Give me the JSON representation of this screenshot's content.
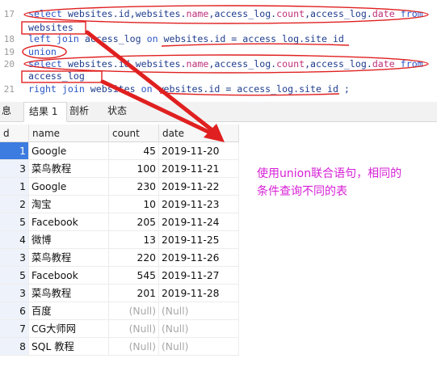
{
  "editor": {
    "lines": [
      {
        "num": "17",
        "tokens": [
          {
            "t": "select ",
            "c": "kw"
          },
          {
            "t": "websites.id,websites.",
            "c": "plain"
          },
          {
            "t": "name",
            "c": "fn"
          },
          {
            "t": ",access_log.",
            "c": "plain"
          },
          {
            "t": "count",
            "c": "fn"
          },
          {
            "t": ",access_log.",
            "c": "plain"
          },
          {
            "t": "date",
            "c": "fn"
          },
          {
            "t": " from",
            "c": "kw"
          }
        ]
      },
      {
        "num": "",
        "tokens": [
          {
            "t": "websites",
            "c": "plain"
          }
        ]
      },
      {
        "num": "18",
        "tokens": [
          {
            "t": "left join ",
            "c": "kw"
          },
          {
            "t": "access_log ",
            "c": "plain"
          },
          {
            "t": "on ",
            "c": "kw"
          },
          {
            "t": "websites.id = access_log.site_id",
            "c": "plain"
          }
        ]
      },
      {
        "num": "19",
        "tokens": [
          {
            "t": "union",
            "c": "kw"
          }
        ]
      },
      {
        "num": "20",
        "tokens": [
          {
            "t": "select ",
            "c": "kw"
          },
          {
            "t": "websites.id,websites.",
            "c": "plain"
          },
          {
            "t": "name",
            "c": "fn"
          },
          {
            "t": ",access_log.",
            "c": "plain"
          },
          {
            "t": "count",
            "c": "fn"
          },
          {
            "t": ",access_log.",
            "c": "plain"
          },
          {
            "t": "date",
            "c": "fn"
          },
          {
            "t": " from",
            "c": "kw"
          }
        ]
      },
      {
        "num": "",
        "tokens": [
          {
            "t": "access_log",
            "c": "plain"
          }
        ]
      },
      {
        "num": "21",
        "tokens": [
          {
            "t": "right join ",
            "c": "kw"
          },
          {
            "t": "websites ",
            "c": "plain"
          },
          {
            "t": "on ",
            "c": "kw"
          },
          {
            "t": "websites.id = access_log.site_id ;",
            "c": "plain"
          }
        ]
      }
    ]
  },
  "tabs": [
    {
      "label": "息"
    },
    {
      "label": "结果 1"
    },
    {
      "label": "剖析"
    },
    {
      "label": "状态"
    }
  ],
  "grid": {
    "headers": [
      "d",
      "name",
      "count",
      "date"
    ],
    "rows": [
      {
        "id": "1",
        "name": "Google",
        "count": "45",
        "date": "2019-11-20"
      },
      {
        "id": "3",
        "name": "菜鸟教程",
        "count": "100",
        "date": "2019-11-21"
      },
      {
        "id": "1",
        "name": "Google",
        "count": "230",
        "date": "2019-11-22"
      },
      {
        "id": "2",
        "name": "淘宝",
        "count": "10",
        "date": "2019-11-23"
      },
      {
        "id": "5",
        "name": "Facebook",
        "count": "205",
        "date": "2019-11-24"
      },
      {
        "id": "4",
        "name": "微博",
        "count": "13",
        "date": "2019-11-25"
      },
      {
        "id": "3",
        "name": "菜鸟教程",
        "count": "220",
        "date": "2019-11-26"
      },
      {
        "id": "5",
        "name": "Facebook",
        "count": "545",
        "date": "2019-11-27"
      },
      {
        "id": "3",
        "name": "菜鸟教程",
        "count": "201",
        "date": "2019-11-28"
      },
      {
        "id": "6",
        "name": "百度",
        "count": "(Null)",
        "date": "(Null)"
      },
      {
        "id": "7",
        "name": "CG大师网",
        "count": "(Null)",
        "date": "(Null)"
      },
      {
        "id": "8",
        "name": "SQL 教程",
        "count": "(Null)",
        "date": "(Null)"
      }
    ]
  },
  "annotation": {
    "line1": "使用union联合语句，相同的",
    "line2": "条件查询不同的表",
    "color": "#d61fd6"
  },
  "colors": {
    "markup_red": "#e02020",
    "selected_row": "#3c7be0"
  }
}
